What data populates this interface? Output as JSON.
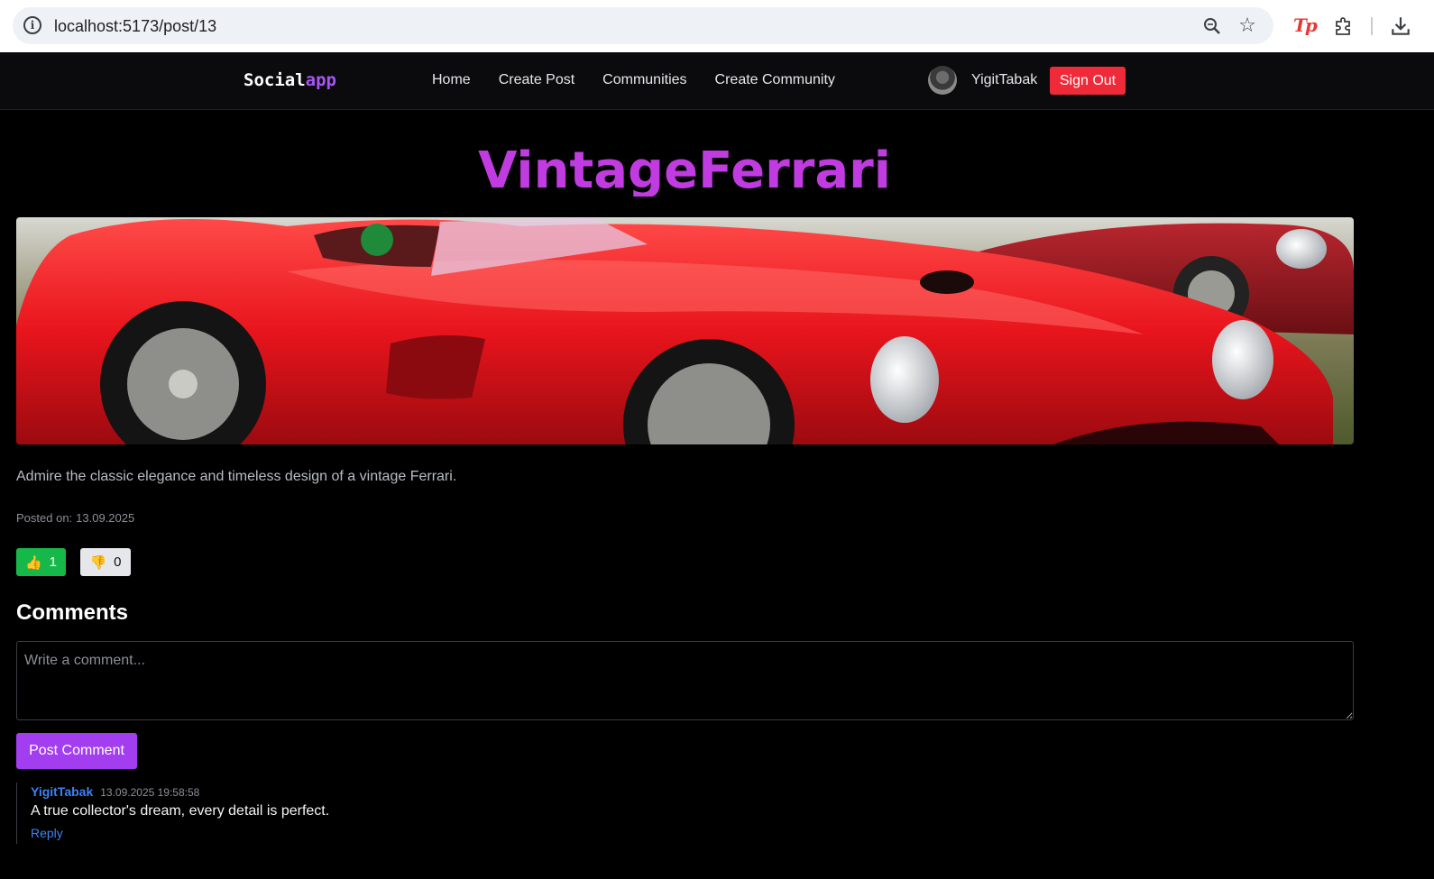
{
  "browser": {
    "url": "localhost:5173/post/13"
  },
  "navbar": {
    "logo_main": "Social",
    "logo_accent": "app",
    "links": [
      "Home",
      "Create Post",
      "Communities",
      "Create Community"
    ],
    "username": "YigitTabak",
    "signout_label": "Sign Out"
  },
  "post": {
    "title": "VintageFerrari",
    "description": "Admire the classic elegance and timeless design of a vintage Ferrari.",
    "posted_label": "Posted on:",
    "posted_date": "13.09.2025",
    "likes": "1",
    "dislikes": "0"
  },
  "comments": {
    "heading": "Comments",
    "placeholder": "Write a comment...",
    "submit_label": "Post Comment",
    "items": [
      {
        "author": "YigitTabak",
        "timestamp": "13.09.2025 19:58:58",
        "text": "A true collector's dream, every detail is perfect.",
        "reply_label": "Reply"
      }
    ]
  },
  "colors": {
    "accent": "#a855f7",
    "title": "#c03be0",
    "signout": "#ef2b3a",
    "like": "#16b84a",
    "link": "#3b82f6"
  }
}
